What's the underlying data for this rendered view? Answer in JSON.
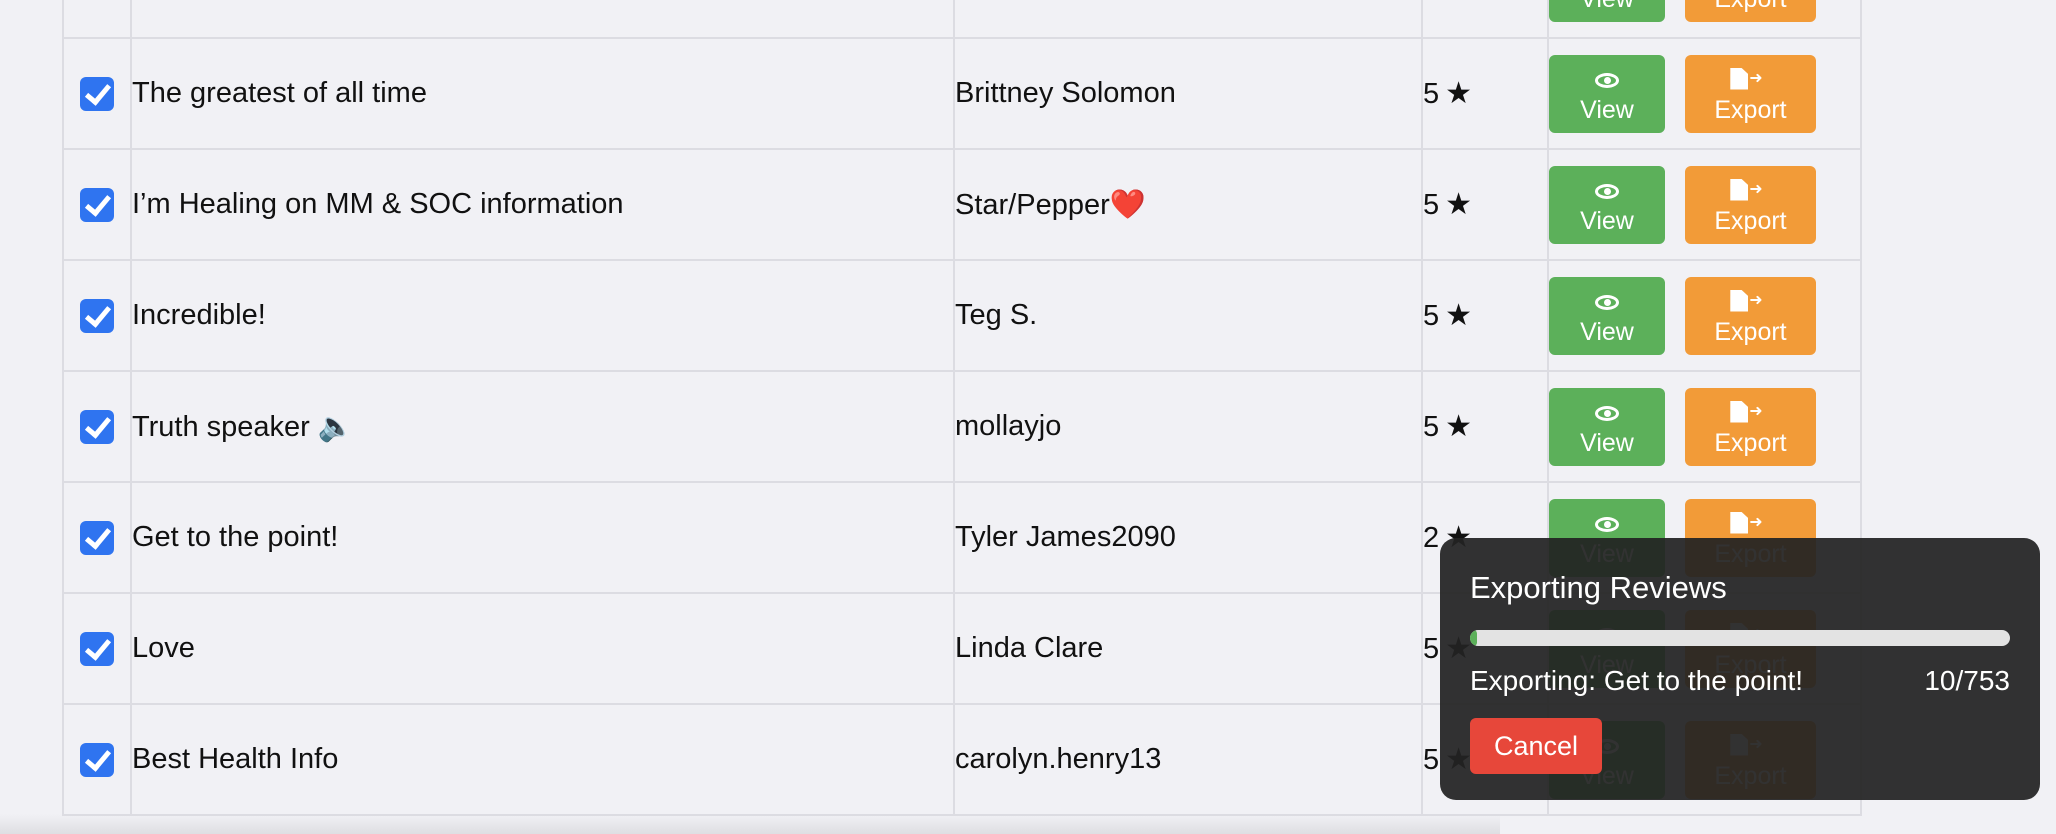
{
  "table": {
    "rows": [
      {
        "title": "",
        "author": "",
        "rating": "",
        "view_label": "View",
        "export_label": "Export"
      },
      {
        "title": "The greatest of all time",
        "author": "Brittney Solomon",
        "rating": "5",
        "view_label": "View",
        "export_label": "Export"
      },
      {
        "title": "I’m Healing on MM & SOC information",
        "author": "Star/Pepper❤️",
        "rating": "5",
        "view_label": "View",
        "export_label": "Export"
      },
      {
        "title": "Incredible!",
        "author": "Teg S.",
        "rating": "5",
        "view_label": "View",
        "export_label": "Export"
      },
      {
        "title": "Truth speaker 🔈",
        "author": "mollayjo",
        "rating": "5",
        "view_label": "View",
        "export_label": "Export"
      },
      {
        "title": "Get to the point!",
        "author": "Tyler James2090",
        "rating": "2",
        "view_label": "View",
        "export_label": "Export"
      },
      {
        "title": "Love",
        "author": "Linda Clare",
        "rating": "5",
        "view_label": "View",
        "export_label": "Export"
      },
      {
        "title": "Best Health Info",
        "author": "carolyn.henry13",
        "rating": "5",
        "view_label": "View",
        "export_label": "Export"
      }
    ],
    "star_glyph": "★",
    "icons": {
      "view": "eye-icon",
      "export": "file-export-icon",
      "checkbox": "checkbox-checked-icon"
    }
  },
  "export_panel": {
    "title": "Exporting Reviews",
    "status": "Exporting: Get to the point!",
    "count": "10/753",
    "progress": 0.0133,
    "cancel_label": "Cancel"
  },
  "colors": {
    "view_button": "#5cb05a",
    "export_button": "#f29b38",
    "checkbox": "#2f74f0",
    "cancel_button": "#e7473a",
    "panel_bg": "#222222",
    "progress_fill": "#5cb05a"
  }
}
